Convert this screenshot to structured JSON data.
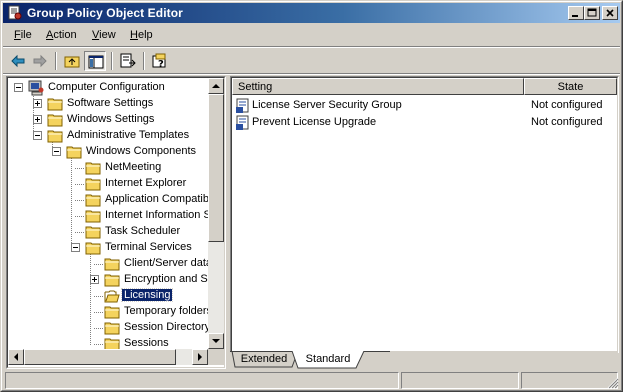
{
  "window": {
    "title": "Group Policy Object Editor",
    "title_bar_color": "#0a246a",
    "controls": [
      "minimize-icon",
      "maximize-icon",
      "close-icon"
    ]
  },
  "menubar": {
    "items": [
      {
        "label": "File",
        "mnemonic": "F",
        "rest": "ile"
      },
      {
        "label": "Action",
        "mnemonic": "A",
        "rest": "ction"
      },
      {
        "label": "View",
        "mnemonic": "V",
        "rest": "iew"
      },
      {
        "label": "Help",
        "mnemonic": "H",
        "rest": "elp"
      }
    ]
  },
  "toolbar": {
    "buttons": [
      "back-arrow-icon",
      "forward-arrow-icon",
      "up-folder-icon",
      "show-hide-tree-icon",
      "export-list-icon",
      "help-icon"
    ]
  },
  "tree": {
    "items": [
      {
        "label": "Computer Configuration",
        "icon": "computer-icon",
        "expander": "minus"
      },
      {
        "label": "Software Settings",
        "icon": "folder-icon",
        "expander": "plus"
      },
      {
        "label": "Windows Settings",
        "icon": "folder-icon",
        "expander": "plus"
      },
      {
        "label": "Administrative Templates",
        "icon": "folder-icon",
        "expander": "minus"
      },
      {
        "label": "Windows Components",
        "icon": "folder-icon",
        "expander": "minus"
      },
      {
        "label": "NetMeeting",
        "icon": "folder-icon",
        "expander": ""
      },
      {
        "label": "Internet Explorer",
        "icon": "folder-icon",
        "expander": ""
      },
      {
        "label": "Application Compatibili",
        "icon": "folder-icon",
        "expander": ""
      },
      {
        "label": "Internet Information S",
        "icon": "folder-icon",
        "expander": ""
      },
      {
        "label": "Task Scheduler",
        "icon": "folder-icon",
        "expander": ""
      },
      {
        "label": "Terminal Services",
        "icon": "folder-icon",
        "expander": "minus"
      },
      {
        "label": "Client/Server data",
        "icon": "folder-icon",
        "expander": ""
      },
      {
        "label": "Encryption and Se",
        "icon": "folder-icon",
        "expander": "plus"
      },
      {
        "label": "Licensing",
        "icon": "open-folder-icon",
        "expander": "",
        "selected": true
      },
      {
        "label": "Temporary folders",
        "icon": "folder-icon",
        "expander": ""
      },
      {
        "label": "Session Directory",
        "icon": "folder-icon",
        "expander": ""
      },
      {
        "label": "Sessions",
        "icon": "folder-icon",
        "expander": ""
      }
    ]
  },
  "list": {
    "columns": [
      "Setting",
      "State"
    ],
    "rows": [
      {
        "setting": "License Server Security Group",
        "state": "Not configured",
        "icon": "policy-setting-icon"
      },
      {
        "setting": "Prevent License Upgrade",
        "state": "Not configured",
        "icon": "policy-setting-icon"
      }
    ]
  },
  "tabs": [
    {
      "label": "Extended",
      "active": false
    },
    {
      "label": "Standard",
      "active": true
    }
  ],
  "colors": {
    "face": "#d4d0c8",
    "selection": "#0a246a",
    "folder": "#f4d35e"
  }
}
